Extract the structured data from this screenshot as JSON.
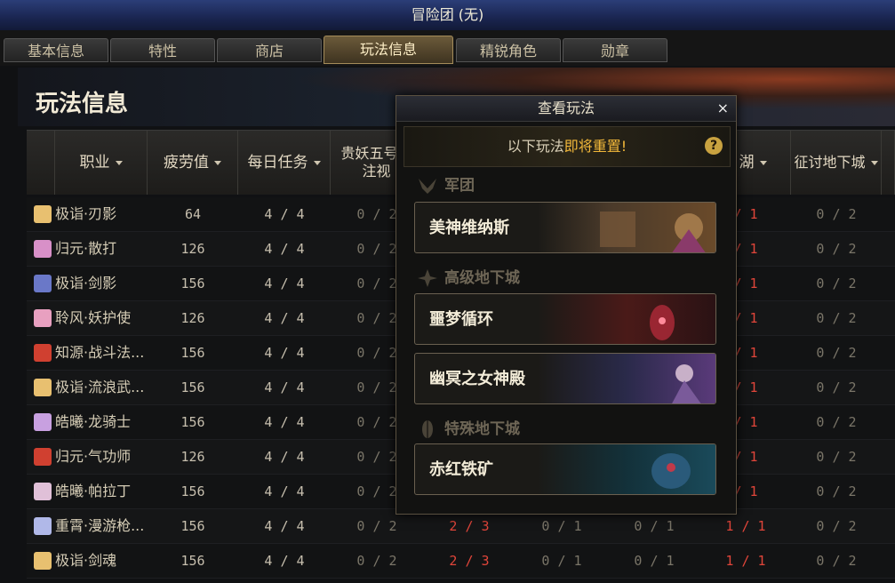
{
  "window": {
    "title": "冒险团 (无)"
  },
  "tabs": [
    {
      "label": "基本信息",
      "active": false
    },
    {
      "label": "特性",
      "active": false
    },
    {
      "label": "商店",
      "active": false
    },
    {
      "label": "玩法信息",
      "active": true
    },
    {
      "label": "精锐角色",
      "active": false
    },
    {
      "label": "勋章",
      "active": false
    }
  ],
  "page": {
    "title": "玩法信息"
  },
  "table": {
    "columns": [
      "职业",
      "疲劳值",
      "每日任务",
      "贵妖五号之注视",
      "",
      "",
      "",
      "月湖",
      "征讨地下城",
      ""
    ],
    "rows": [
      {
        "name": "极诣·刃影",
        "fatigue": "64",
        "daily": "4 / 4",
        "c3": "0 / 2",
        "c4": "",
        "c5": "",
        "c6": "",
        "c7": "/ 1",
        "c8": "0 / 2"
      },
      {
        "name": "归元·散打",
        "fatigue": "126",
        "daily": "4 / 4",
        "c3": "0 / 2",
        "c4": "",
        "c5": "",
        "c6": "",
        "c7": "/ 1",
        "c8": "0 / 2"
      },
      {
        "name": "极诣·剑影",
        "fatigue": "156",
        "daily": "4 / 4",
        "c3": "0 / 2",
        "c4": "",
        "c5": "",
        "c6": "",
        "c7": "/ 1",
        "c8": "0 / 2"
      },
      {
        "name": "聆风·妖护使",
        "fatigue": "126",
        "daily": "4 / 4",
        "c3": "0 / 2",
        "c4": "",
        "c5": "",
        "c6": "",
        "c7": "/ 1",
        "c8": "0 / 2"
      },
      {
        "name": "知源·战斗法...",
        "fatigue": "156",
        "daily": "4 / 4",
        "c3": "0 / 2",
        "c4": "",
        "c5": "",
        "c6": "",
        "c7": "/ 1",
        "c8": "0 / 2"
      },
      {
        "name": "极诣·流浪武...",
        "fatigue": "156",
        "daily": "4 / 4",
        "c3": "0 / 2",
        "c4": "",
        "c5": "",
        "c6": "",
        "c7": "/ 1",
        "c8": "0 / 2"
      },
      {
        "name": "皓曦·龙骑士",
        "fatigue": "156",
        "daily": "4 / 4",
        "c3": "0 / 2",
        "c4": "",
        "c5": "",
        "c6": "",
        "c7": "/ 1",
        "c8": "0 / 2"
      },
      {
        "name": "归元·气功师",
        "fatigue": "126",
        "daily": "4 / 4",
        "c3": "0 / 2",
        "c4": "",
        "c5": "",
        "c6": "",
        "c7": "/ 1",
        "c8": "0 / 2"
      },
      {
        "name": "皓曦·帕拉丁",
        "fatigue": "156",
        "daily": "4 / 4",
        "c3": "0 / 2",
        "c4": "",
        "c5": "",
        "c6": "",
        "c7": "/ 1",
        "c8": "0 / 2"
      },
      {
        "name": "重霄·漫游枪...",
        "fatigue": "156",
        "daily": "4 / 4",
        "c3": "0 / 2",
        "c4": "2 / 3",
        "c5": "0 / 1",
        "c6": "0 / 1",
        "c7": "1 / 1",
        "c8": "0 / 2"
      },
      {
        "name": "极诣·剑魂",
        "fatigue": "156",
        "daily": "4 / 4",
        "c3": "0 / 2",
        "c4": "2 / 3",
        "c5": "0 / 1",
        "c6": "0 / 1",
        "c7": "1 / 1",
        "c8": "0 / 2"
      }
    ]
  },
  "popup": {
    "title": "查看玩法",
    "close": "×",
    "notice_prefix": "以下玩法",
    "notice_highlight": "即将重置!",
    "help": "?",
    "sections": [
      {
        "category": "军团",
        "items": [
          "美神维纳斯"
        ]
      },
      {
        "category": "高级地下城",
        "items": [
          "噩梦循环",
          "幽冥之女神殿"
        ]
      },
      {
        "category": "特殊地下城",
        "items": [
          "赤红铁矿"
        ]
      }
    ]
  },
  "colors": {
    "highlight": "#f2b83a",
    "red_value": "#e0453a",
    "title_bar": "#1a2550"
  }
}
